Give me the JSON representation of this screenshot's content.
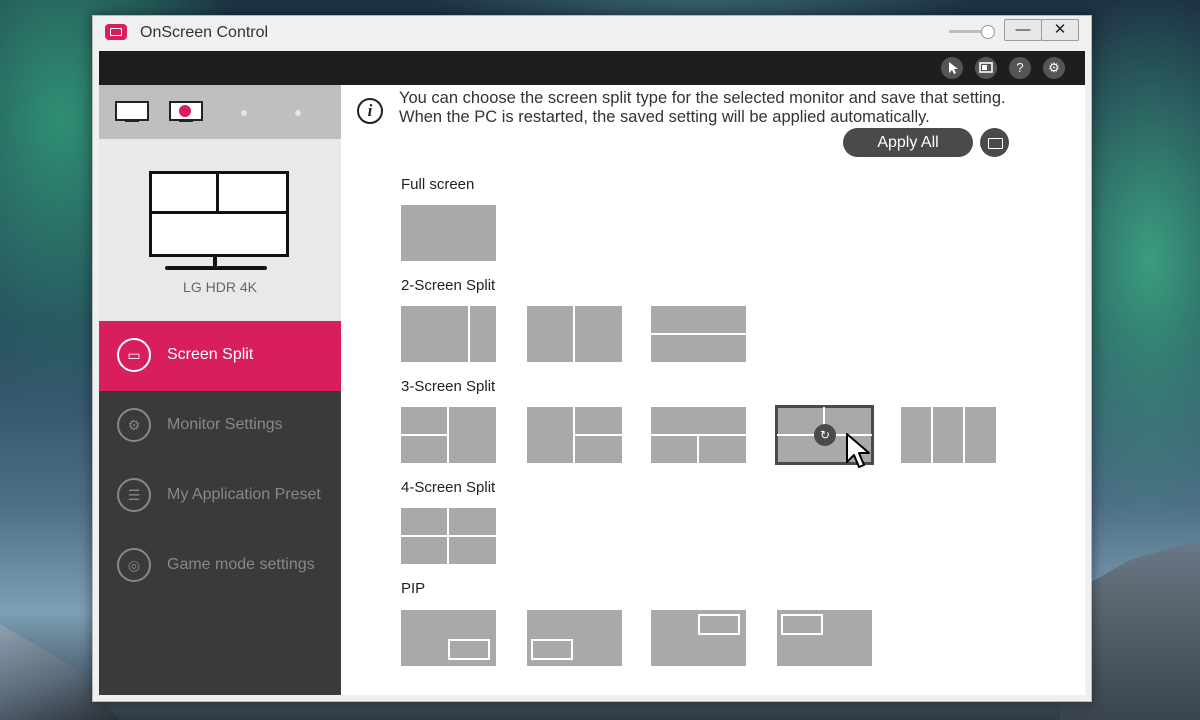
{
  "window": {
    "title": "OnScreen Control",
    "minimize_glyph": "—",
    "close_glyph": "✕"
  },
  "toolbar": {
    "icons": [
      "cursor-icon",
      "monitor-icon",
      "help-icon",
      "settings-icon"
    ],
    "help_glyph": "?",
    "settings_glyph": "⚙"
  },
  "sidebar": {
    "monitor_name": "LG HDR 4K",
    "items": [
      {
        "label": "Screen Split",
        "icon": "screen-split-icon",
        "glyph": "▭"
      },
      {
        "label": "Monitor Settings",
        "icon": "monitor-settings-icon",
        "glyph": "⚙"
      },
      {
        "label": "My Application Preset",
        "icon": "app-preset-icon",
        "glyph": "☰"
      },
      {
        "label": "Game mode settings",
        "icon": "gamepad-icon",
        "glyph": "◎"
      }
    ]
  },
  "main": {
    "info_glyph": "i",
    "info_line1": "You can choose the screen split type for the selected monitor and save that setting.",
    "info_line2": "When the PC is restarted, the saved setting will be applied automatically.",
    "apply_all_label": "Apply All",
    "sections": {
      "full": "Full screen",
      "two": "2-Screen Split",
      "three": "3-Screen Split",
      "four": "4-Screen Split",
      "pip": "PIP"
    },
    "selected_glyph": "↻"
  },
  "colors": {
    "accent": "#d81e5b",
    "sidebar_bg": "#3a3a3a",
    "tile": "#a9a9a9",
    "toolbar": "#1e1e1e"
  }
}
